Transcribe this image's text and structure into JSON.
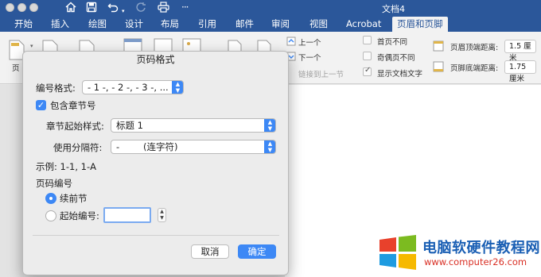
{
  "window": {
    "title": "文档4",
    "quick_access_icons": [
      "home-icon",
      "save-icon",
      "undo-icon",
      "redo-icon",
      "print-icon",
      "more-icon"
    ]
  },
  "ribbon": {
    "tabs": [
      "开始",
      "插入",
      "绘图",
      "设计",
      "布局",
      "引用",
      "邮件",
      "审阅",
      "视图",
      "Acrobat",
      "页眉和页脚"
    ],
    "active_tab": "页眉和页脚",
    "nav": {
      "prev": "上一个",
      "next": "下一个",
      "link_prev": "链接到上一节"
    },
    "options": {
      "first_page_different": "首页不同",
      "odd_even_different": "奇偶页不同",
      "show_document_text": "显示文档文字",
      "first_page_different_checked": false,
      "odd_even_different_checked": false,
      "show_document_text_checked": true
    },
    "positions": {
      "header_top_label": "页眉顶端距离:",
      "header_top_value": "1.5 厘米",
      "footer_bottom_label": "页脚底端距离:",
      "footer_bottom_value": "1.75 厘米"
    },
    "partial_label": "页"
  },
  "dialog": {
    "title": "页码格式",
    "number_format_label": "编号格式:",
    "number_format_value": "- 1 -, - 2 -, - 3 -, ...",
    "include_chapter_label": "包含章节号",
    "include_chapter_checked": true,
    "chapter_style_label": "章节起始样式:",
    "chapter_style_value": "标题 1",
    "separator_label": "使用分隔符:",
    "separator_value": "-",
    "separator_desc": "(连字符)",
    "example": "示例: 1-1, 1-A",
    "page_numbering_label": "页码编号",
    "continue_label": "续前节",
    "continue_selected": true,
    "start_at_label": "起始编号:",
    "start_at_value": "",
    "cancel_label": "取消",
    "ok_label": "确定"
  },
  "watermark": {
    "brand": "电脑软硬件教程网",
    "url": "www.computer26.com"
  }
}
